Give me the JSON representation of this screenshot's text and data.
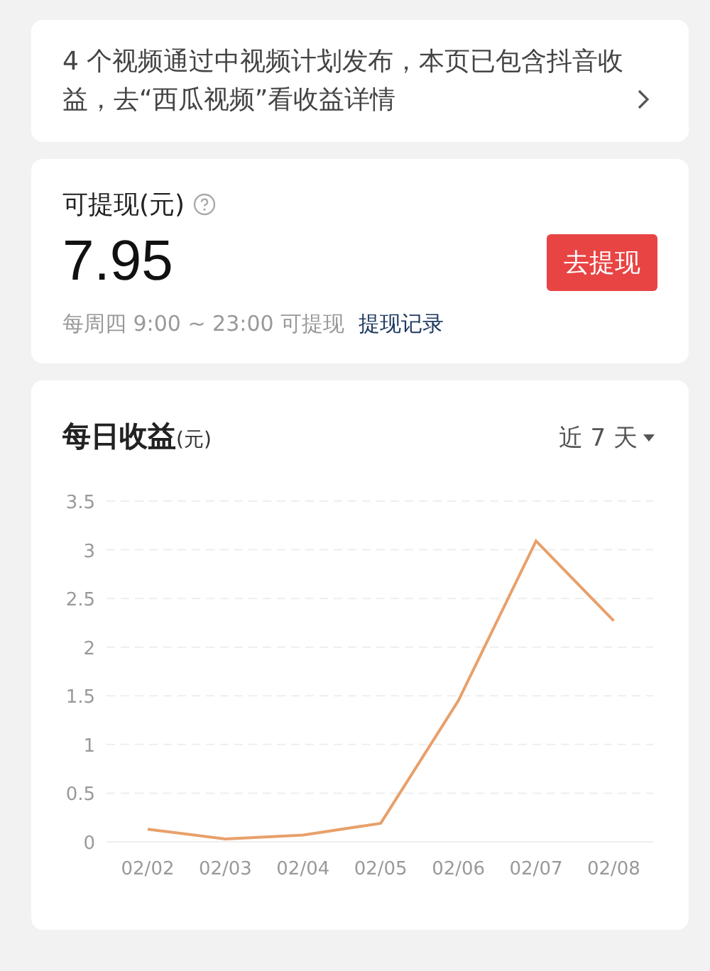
{
  "notice": {
    "text": "4 个视频通过中视频计划发布，本页已包含抖音收益，去“西瓜视频”看收益详情"
  },
  "withdraw": {
    "label": "可提现(元)",
    "amount": "7.95",
    "button": "去提现",
    "schedule": "每周四 9:00 ~ 23:00 可提现",
    "link": "提现记录"
  },
  "daily": {
    "title": "每日收益",
    "unit": "(元)",
    "range": "近 7 天",
    "chart_data": {
      "type": "line",
      "grid": true,
      "categories": [
        "02/02",
        "02/03",
        "02/04",
        "02/05",
        "02/06",
        "02/07",
        "02/08"
      ],
      "ylim": [
        0,
        3.5
      ],
      "yticks": [
        0,
        0.5,
        1,
        1.5,
        2,
        2.5,
        3,
        3.5
      ],
      "series": [
        {
          "color": "#e8a06a",
          "values": [
            0.13,
            0.03,
            0.07,
            0.19,
            1.45,
            3.09,
            2.27
          ]
        }
      ]
    }
  }
}
